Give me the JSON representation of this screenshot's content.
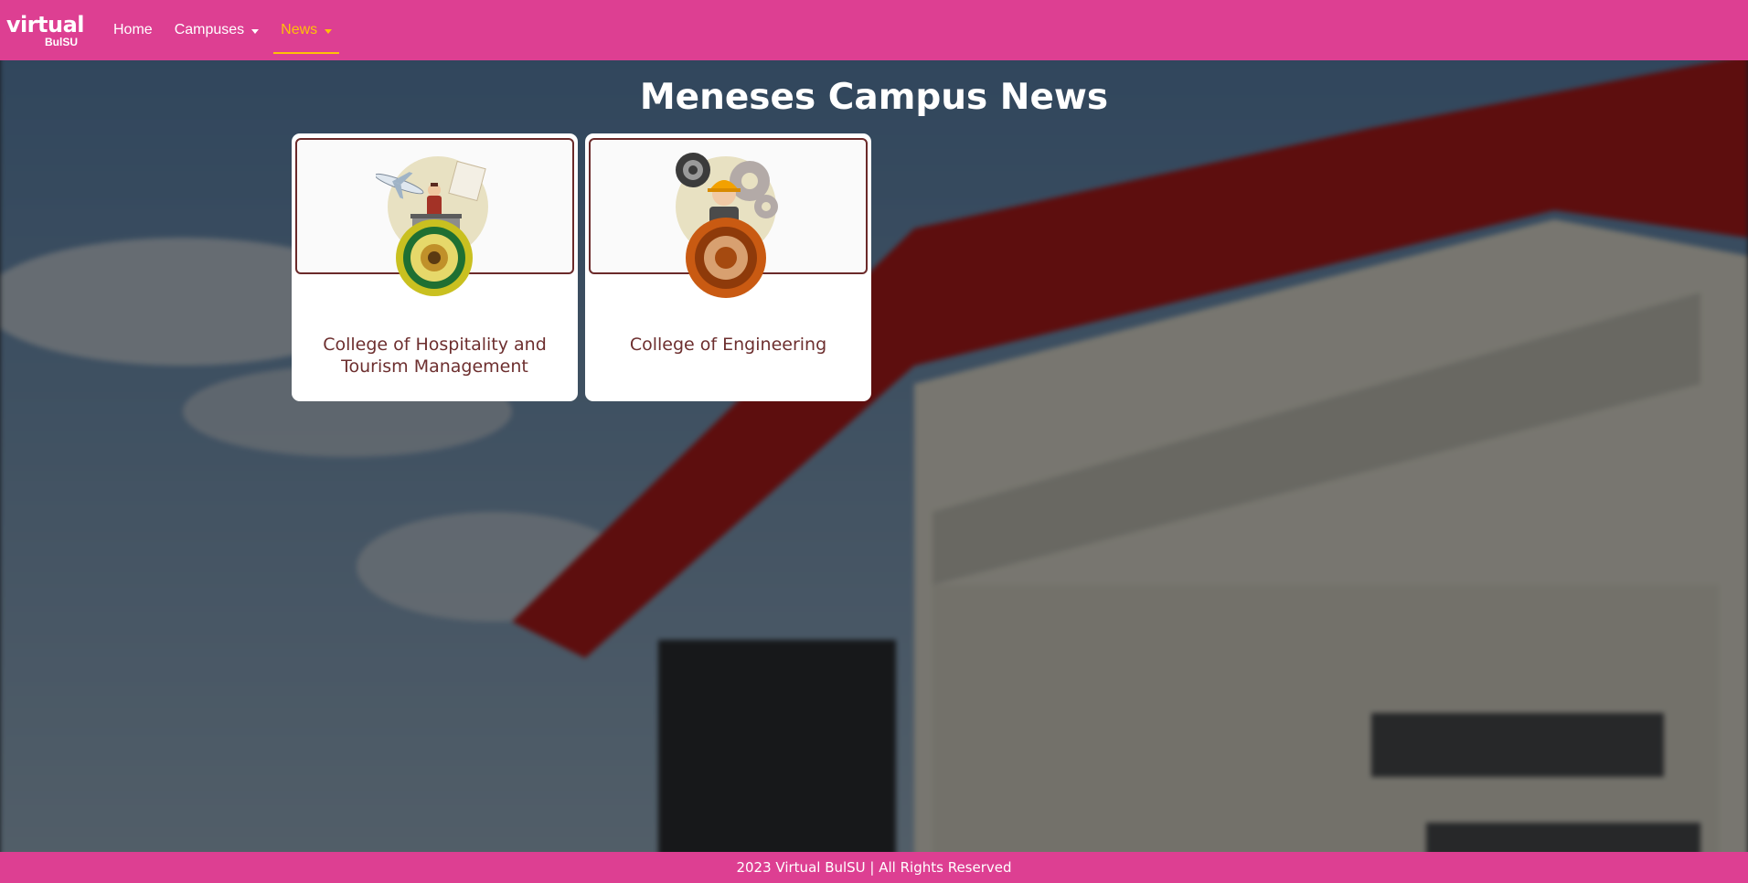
{
  "navbar": {
    "brand_top": "virtual",
    "brand_bottom": "BulSU",
    "items": [
      {
        "label": "Home"
      },
      {
        "label": "Campuses"
      },
      {
        "label": "News"
      }
    ],
    "background_color": "#dd3f92",
    "active_color": "#ffc107"
  },
  "main": {
    "title": "Meneses Campus News",
    "cards": [
      {
        "label": "College of Hospitality and Tourism Management",
        "icon": "hospitality-tourism-icon"
      },
      {
        "label": "College of Engineering",
        "icon": "engineering-icon"
      }
    ]
  },
  "footer": {
    "text": "2023 Virtual BulSU | All Rights Reserved"
  }
}
